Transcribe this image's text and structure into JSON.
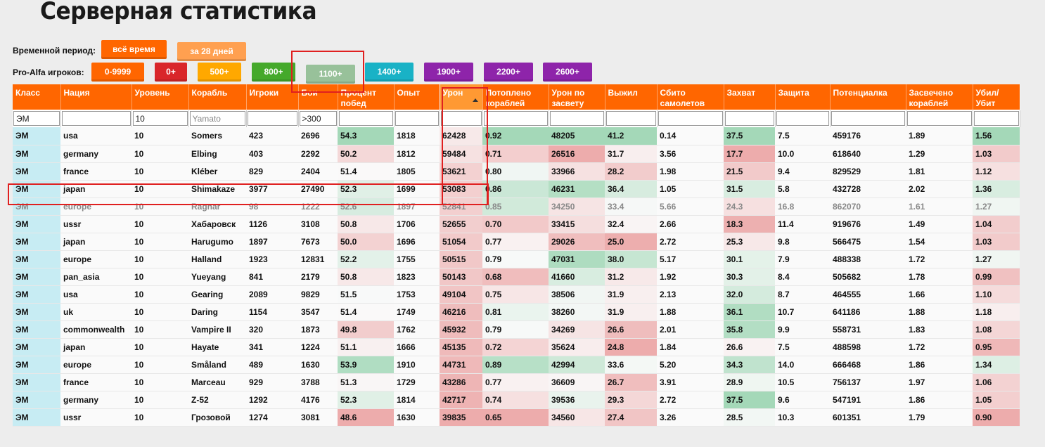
{
  "page_title": "Серверная статистика",
  "period": {
    "label": "Временной период:",
    "options": [
      {
        "label": "всё время",
        "color": "#ff6600"
      },
      {
        "label": "за 28 дней",
        "color": "#ffa050"
      }
    ]
  },
  "players": {
    "label": "Pro-Alfa игроков:",
    "options": [
      {
        "label": "0-9999",
        "color": "#ff6600"
      },
      {
        "label": "0+",
        "color": "#d9262a"
      },
      {
        "label": "500+",
        "color": "#ffa800"
      },
      {
        "label": "800+",
        "color": "#45a92b"
      },
      {
        "label": "1100+",
        "color": "#98c19a"
      },
      {
        "label": "1400+",
        "color": "#19b2c6"
      },
      {
        "label": "1900+",
        "color": "#8e24aa"
      },
      {
        "label": "2200+",
        "color": "#8e24aa"
      },
      {
        "label": "2600+",
        "color": "#8e24aa"
      }
    ]
  },
  "table": {
    "columns": [
      "Класс",
      "Нация",
      "Уровень",
      "Корабль",
      "Игроки",
      "Бои",
      "Процент побед",
      "Опыт",
      "Урон",
      "Потоплено кораблей",
      "Урон по засвету",
      "Выжил",
      "Сбито самолетов",
      "Захват",
      "Защита",
      "Потенциалка",
      "Засвечено кораблей",
      "Убил/ Убит"
    ],
    "sorted_column": "Урон",
    "filters": {
      "class_value": "ЭМ",
      "level_value": "10",
      "ship_placeholder": "Yamato",
      "battles_value": ">300"
    },
    "rows": [
      [
        "ЭМ",
        "usa",
        "10",
        "Somers",
        "423",
        "2696",
        "54.3",
        "1818",
        "62428",
        "0.92",
        "48205",
        "41.2",
        "0.14",
        "37.5",
        "7.5",
        "459176",
        "1.89",
        "1.56"
      ],
      [
        "ЭМ",
        "germany",
        "10",
        "Elbing",
        "403",
        "2292",
        "50.2",
        "1812",
        "59484",
        "0.71",
        "26516",
        "31.7",
        "3.56",
        "17.7",
        "10.0",
        "618640",
        "1.29",
        "1.03"
      ],
      [
        "ЭМ",
        "france",
        "10",
        "Kléber",
        "829",
        "2404",
        "51.4",
        "1805",
        "53621",
        "0.80",
        "33966",
        "28.2",
        "1.98",
        "21.5",
        "9.4",
        "829529",
        "1.81",
        "1.12"
      ],
      [
        "ЭМ",
        "japan",
        "10",
        "Shimakaze",
        "3977",
        "27490",
        "52.3",
        "1699",
        "53083",
        "0.86",
        "46231",
        "36.4",
        "1.05",
        "31.5",
        "5.8",
        "432728",
        "2.02",
        "1.36"
      ],
      [
        "ЭМ",
        "europe",
        "10",
        "Ragnar",
        "98",
        "1222",
        "52.6",
        "1897",
        "52841",
        "0.85",
        "34250",
        "33.4",
        "5.66",
        "24.3",
        "16.8",
        "862070",
        "1.61",
        "1.27"
      ],
      [
        "ЭМ",
        "ussr",
        "10",
        "Хабаровск",
        "1126",
        "3108",
        "50.8",
        "1706",
        "52655",
        "0.70",
        "33415",
        "32.4",
        "2.66",
        "18.3",
        "11.4",
        "919676",
        "1.49",
        "1.04"
      ],
      [
        "ЭМ",
        "japan",
        "10",
        "Harugumo",
        "1897",
        "7673",
        "50.0",
        "1696",
        "51054",
        "0.77",
        "29026",
        "25.0",
        "2.72",
        "25.3",
        "9.8",
        "566475",
        "1.54",
        "1.03"
      ],
      [
        "ЭМ",
        "europe",
        "10",
        "Halland",
        "1923",
        "12831",
        "52.2",
        "1755",
        "50515",
        "0.79",
        "47031",
        "38.0",
        "5.17",
        "30.1",
        "7.9",
        "488338",
        "1.72",
        "1.27"
      ],
      [
        "ЭМ",
        "pan_asia",
        "10",
        "Yueyang",
        "841",
        "2179",
        "50.8",
        "1823",
        "50143",
        "0.68",
        "41660",
        "31.2",
        "1.92",
        "30.3",
        "8.4",
        "505682",
        "1.78",
        "0.99"
      ],
      [
        "ЭМ",
        "usa",
        "10",
        "Gearing",
        "2089",
        "9829",
        "51.5",
        "1753",
        "49104",
        "0.75",
        "38506",
        "31.9",
        "2.13",
        "32.0",
        "8.7",
        "464555",
        "1.66",
        "1.10"
      ],
      [
        "ЭМ",
        "uk",
        "10",
        "Daring",
        "1154",
        "3547",
        "51.4",
        "1749",
        "46216",
        "0.81",
        "38260",
        "31.9",
        "1.88",
        "36.1",
        "10.7",
        "641186",
        "1.88",
        "1.18"
      ],
      [
        "ЭМ",
        "commonwealth",
        "10",
        "Vampire II",
        "320",
        "1873",
        "49.8",
        "1762",
        "45932",
        "0.79",
        "34269",
        "26.6",
        "2.01",
        "35.8",
        "9.9",
        "558731",
        "1.83",
        "1.08"
      ],
      [
        "ЭМ",
        "japan",
        "10",
        "Hayate",
        "341",
        "1224",
        "51.1",
        "1666",
        "45135",
        "0.72",
        "35624",
        "24.8",
        "1.84",
        "26.6",
        "7.5",
        "488598",
        "1.72",
        "0.95"
      ],
      [
        "ЭМ",
        "europe",
        "10",
        "Småland",
        "489",
        "1630",
        "53.9",
        "1910",
        "44731",
        "0.89",
        "42994",
        "33.6",
        "5.20",
        "34.3",
        "14.0",
        "666468",
        "1.86",
        "1.34"
      ],
      [
        "ЭМ",
        "france",
        "10",
        "Marceau",
        "929",
        "3788",
        "51.3",
        "1729",
        "43286",
        "0.77",
        "36609",
        "26.7",
        "3.91",
        "28.9",
        "10.5",
        "756137",
        "1.97",
        "1.06"
      ],
      [
        "ЭМ",
        "germany",
        "10",
        "Z-52",
        "1292",
        "4176",
        "52.3",
        "1814",
        "42717",
        "0.74",
        "39536",
        "29.3",
        "2.72",
        "37.5",
        "9.6",
        "547191",
        "1.86",
        "1.05"
      ],
      [
        "ЭМ",
        "ussr",
        "10",
        "Грозовой",
        "1274",
        "3081",
        "48.6",
        "1630",
        "39835",
        "0.65",
        "34560",
        "27.4",
        "3.26",
        "28.5",
        "10.3",
        "601351",
        "1.79",
        "0.90"
      ]
    ],
    "dimmed_row_index": 4
  },
  "colors": {
    "header_orange": "#ff6600",
    "sorted_header": "#ff9933",
    "class_cell": "#c7ecf3",
    "good_green": "#8fd0a8",
    "bad_red": "#eba3a3",
    "highlight_outline": "#e02020"
  }
}
